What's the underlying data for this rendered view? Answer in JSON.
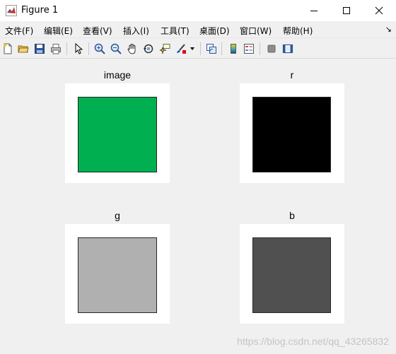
{
  "window": {
    "title": "Figure 1"
  },
  "menubar": {
    "items": [
      {
        "label": "文件(F)"
      },
      {
        "label": "编辑(E)"
      },
      {
        "label": "查看(V)"
      },
      {
        "label": "插入(I)"
      },
      {
        "label": "工具(T)"
      },
      {
        "label": "桌面(D)"
      },
      {
        "label": "窗口(W)"
      },
      {
        "label": "帮助(H)"
      }
    ],
    "overflow_arrow": "↘"
  },
  "toolbar": {
    "icons": [
      "new-figure-icon",
      "open-file-icon",
      "save-icon",
      "print-icon",
      "pointer-icon",
      "zoom-in-icon",
      "zoom-out-icon",
      "pan-icon",
      "rotate-3d-icon",
      "data-cursor-icon",
      "brush-icon",
      "link-plot-icon",
      "colorbar-icon",
      "legend-icon",
      "hide-plot-tools-icon",
      "show-plot-tools-icon"
    ]
  },
  "subplots": [
    {
      "title": "image",
      "color": "#00b050"
    },
    {
      "title": "r",
      "color": "#000000"
    },
    {
      "title": "g",
      "color": "#b0b0b0"
    },
    {
      "title": "b",
      "color": "#505050"
    }
  ],
  "watermark": "https://blog.csdn.net/qq_43265832"
}
